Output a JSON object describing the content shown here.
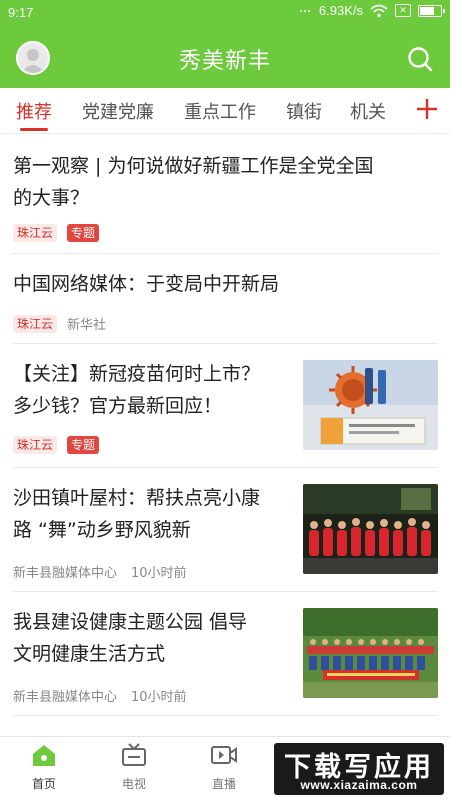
{
  "status_bar": {
    "time": "9:17",
    "speed": "6.93K/s"
  },
  "header": {
    "title": "秀美新丰"
  },
  "tabs": [
    {
      "label": "推荐",
      "active": true
    },
    {
      "label": "党建党廉",
      "active": false
    },
    {
      "label": "重点工作",
      "active": false
    },
    {
      "label": "镇街",
      "active": false
    },
    {
      "label": "机关",
      "active": false
    }
  ],
  "feed": [
    {
      "title_line1": "第一观察 | 为何说做好新疆工作是全党全国",
      "title_line2": "的大事？",
      "source": "珠江云",
      "tag": "专题"
    },
    {
      "title_line1": "中国网络媒体：于变局中开新局",
      "source": "珠江云",
      "publisher": "新华社"
    },
    {
      "title_line1": "【关注】新冠疫苗何时上市？",
      "title_line2": "多少钱？官方最新回应！",
      "source": "珠江云",
      "tag": "专题",
      "thumb": "vaccine-thumbnail"
    },
    {
      "title_line1": "沙田镇叶屋村：帮扶点亮小康",
      "title_line2": "路 “舞”动乡野风貌新",
      "publisher": "新丰县融媒体中心",
      "time": "10小时前",
      "thumb": "dance-thumbnail"
    },
    {
      "title_line1": "我县建设健康主题公园 倡导",
      "title_line2": "文明健康生活方式",
      "publisher": "新丰县融媒体中心",
      "time": "10小时前",
      "thumb": "park-group-thumbnail"
    }
  ],
  "bottom_nav": [
    {
      "label": "首页",
      "icon": "home-icon",
      "active": true
    },
    {
      "label": "电视",
      "icon": "tv-icon",
      "active": false
    },
    {
      "label": "直播",
      "icon": "live-icon",
      "active": false
    }
  ],
  "watermark": {
    "title": "下载写应用",
    "url": "www.xiazaima.com"
  },
  "colors": {
    "brand_green": "#6cca3c",
    "accent_red": "#d9302b"
  }
}
